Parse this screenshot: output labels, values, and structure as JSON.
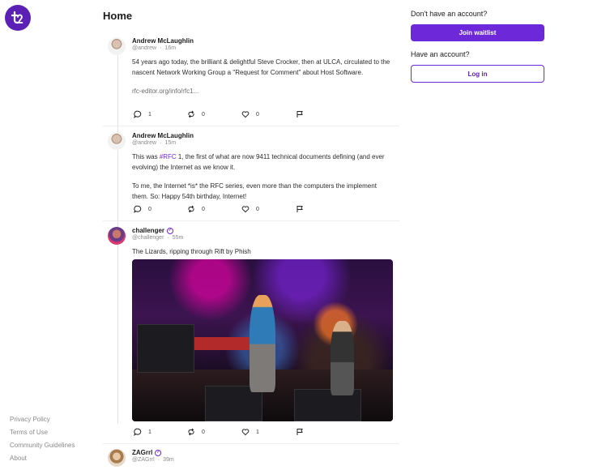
{
  "brand": {
    "logo_text": "t2",
    "accent": "#6d28d9"
  },
  "page": {
    "title": "Home"
  },
  "footer": {
    "links": [
      "Privacy Policy",
      "Terms of Use",
      "Community Guidelines",
      "About"
    ]
  },
  "posts": [
    {
      "name": "Andrew McLaughlin",
      "handle": "@andrew",
      "time": "16m",
      "paragraphs": [
        "54 years ago today, the brilliant & delightful Steve Crocker, then at ULCA, circulated to the nascent Network Working Group a \"Request for Comment\" about Host Software."
      ],
      "link": "rfc-editor.org/info/rfc1...",
      "replies": "1",
      "reposts": "0",
      "likes": "0"
    },
    {
      "name": "Andrew McLaughlin",
      "handle": "@andrew",
      "time": "15m",
      "p1_before": "This was ",
      "p1_tag": "#RFC",
      "p1_after": " 1, the first of what are now 9411 technical documents defining (and ever evolving) the Internet as we know it.",
      "p2": "To me, the Internet *is* the RFC series, even more than the computers the implement them. So: Happy 54th birthday, Internet!",
      "replies": "0",
      "reposts": "0",
      "likes": "0"
    },
    {
      "name": "challenger",
      "handle": "@challenger",
      "time": "55m",
      "text": "The Lizards, ripping through Rift by Phish",
      "replies": "1",
      "reposts": "0",
      "likes": "1"
    },
    {
      "name": "ZAGrrl",
      "handle": "@ZAGrrl",
      "time": "39m"
    }
  ],
  "aside": {
    "no_account": "Don't have an account?",
    "join_label": "Join waitlist",
    "have_account": "Have an account?",
    "login_label": "Log in"
  }
}
